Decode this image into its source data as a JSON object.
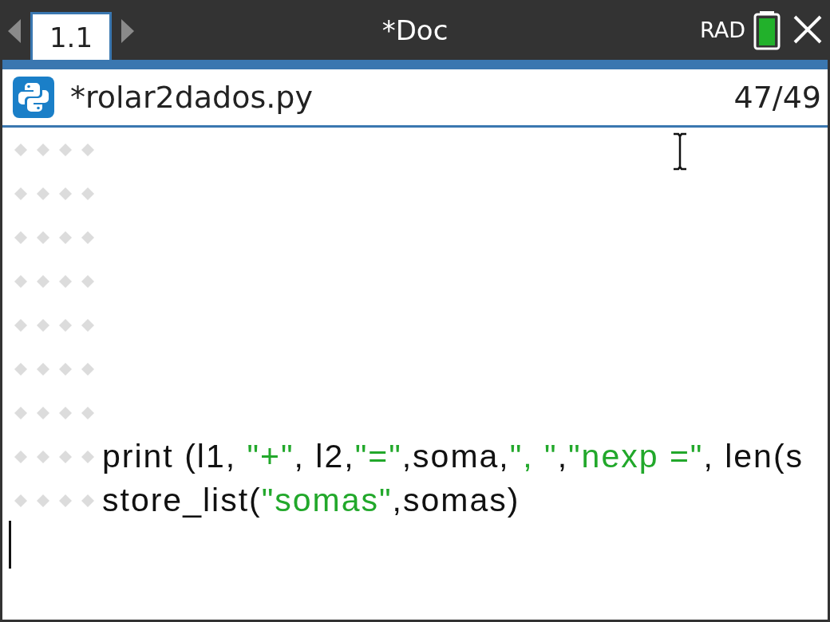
{
  "tab_bar": {
    "tabs": [
      {
        "label": "1.1",
        "selected": true
      }
    ],
    "title": "*Doc",
    "angle_mode": "RAD"
  },
  "editor": {
    "file_name": "*rolar2dados.py",
    "line_position": "47/49",
    "lines": [
      {
        "kind": "indented"
      },
      {
        "kind": "indented"
      },
      {
        "kind": "indented"
      },
      {
        "kind": "indented"
      },
      {
        "kind": "indented"
      },
      {
        "kind": "indented"
      },
      {
        "kind": "indented"
      },
      {
        "kind": "indented",
        "tokens": [
          {
            "kind": "plain",
            "text": "print (l1, "
          },
          {
            "kind": "string",
            "text": "\"+\""
          },
          {
            "kind": "plain",
            "text": ", l2,"
          },
          {
            "kind": "string",
            "text": "\"=\""
          },
          {
            "kind": "plain",
            "text": ",soma,"
          },
          {
            "kind": "string",
            "text": "\", \""
          },
          {
            "kind": "plain",
            "text": ","
          },
          {
            "kind": "string",
            "text": "\"nexp =\""
          },
          {
            "kind": "plain",
            "text": ", len(s"
          }
        ]
      },
      {
        "kind": "indented",
        "tokens": [
          {
            "kind": "plain",
            "text": "store_list("
          },
          {
            "kind": "string",
            "text": "\"somas\""
          },
          {
            "kind": "plain",
            "text": ",somas)"
          }
        ]
      },
      {
        "kind": "cursor"
      }
    ]
  }
}
